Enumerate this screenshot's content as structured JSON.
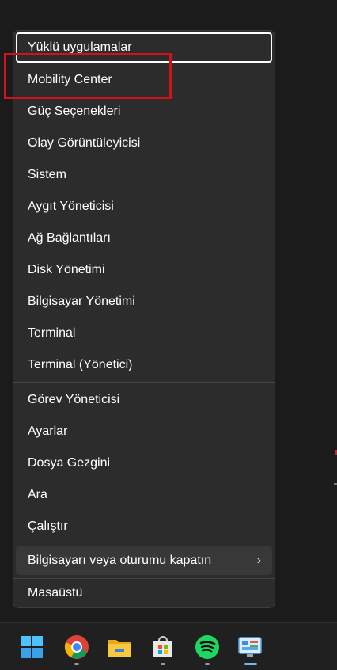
{
  "menu": {
    "items": [
      {
        "label": "Yüklü uygulamalar"
      },
      {
        "label": "Mobility Center"
      },
      {
        "label": "Güç Seçenekleri"
      },
      {
        "label": "Olay Görüntüleyicisi"
      },
      {
        "label": "Sistem"
      },
      {
        "label": "Aygıt Yöneticisi"
      },
      {
        "label": "Ağ Bağlantıları"
      },
      {
        "label": "Disk Yönetimi"
      },
      {
        "label": "Bilgisayar Yönetimi"
      },
      {
        "label": "Terminal"
      },
      {
        "label": "Terminal (Yönetici)"
      },
      {
        "label": "Görev Yöneticisi"
      },
      {
        "label": "Ayarlar"
      },
      {
        "label": "Dosya Gezgini"
      },
      {
        "label": "Ara"
      },
      {
        "label": "Çalıştır"
      },
      {
        "label": "Bilgisayarı veya oturumu kapatın"
      },
      {
        "label": "Masaüstü"
      }
    ],
    "submenu_indicator": "›"
  },
  "annotation": {
    "color": "#d4101b"
  },
  "taskbar": {
    "icons": [
      "windows-start-icon",
      "chrome-icon",
      "file-explorer-icon",
      "microsoft-store-icon",
      "spotify-icon",
      "control-panel-icon"
    ]
  }
}
